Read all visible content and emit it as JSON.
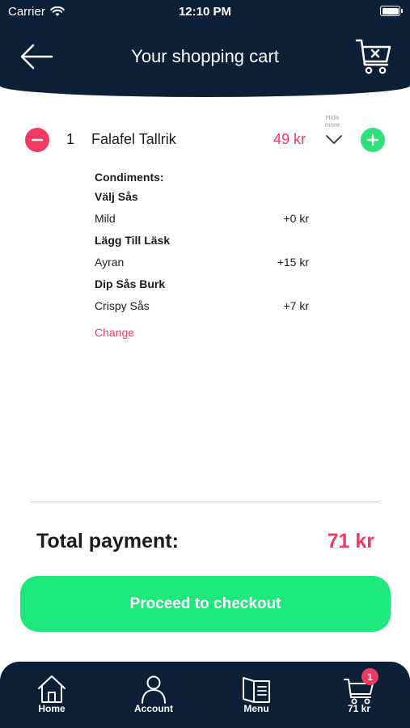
{
  "status_bar": {
    "carrier": "Carrier",
    "time": "12:10 PM"
  },
  "header": {
    "title": "Your shopping cart"
  },
  "cart_item": {
    "quantity": "1",
    "name": "Falafel Tallrik",
    "price": "49 kr",
    "toggle_label": "Hide more",
    "condiments_label": "Condiments:",
    "groups": [
      {
        "title": "Välj Sås",
        "option": "Mild",
        "price": "+0 kr"
      },
      {
        "title": "Lägg Till Läsk",
        "option": "Ayran",
        "price": "+15 kr"
      },
      {
        "title": "Dip Sås Burk",
        "option": "Crispy Sås",
        "price": "+7 kr"
      }
    ],
    "change_label": "Change"
  },
  "total": {
    "label": "Total payment:",
    "value": "71 kr"
  },
  "checkout_button": "Proceed to checkout",
  "tabbar": {
    "home": "Home",
    "account": "Account",
    "menu": "Menu",
    "cart": "71 kr",
    "cart_badge": "1"
  },
  "colors": {
    "navy": "#0e2038",
    "accent_pink": "#f03a5f",
    "accent_green": "#1ee87b"
  }
}
